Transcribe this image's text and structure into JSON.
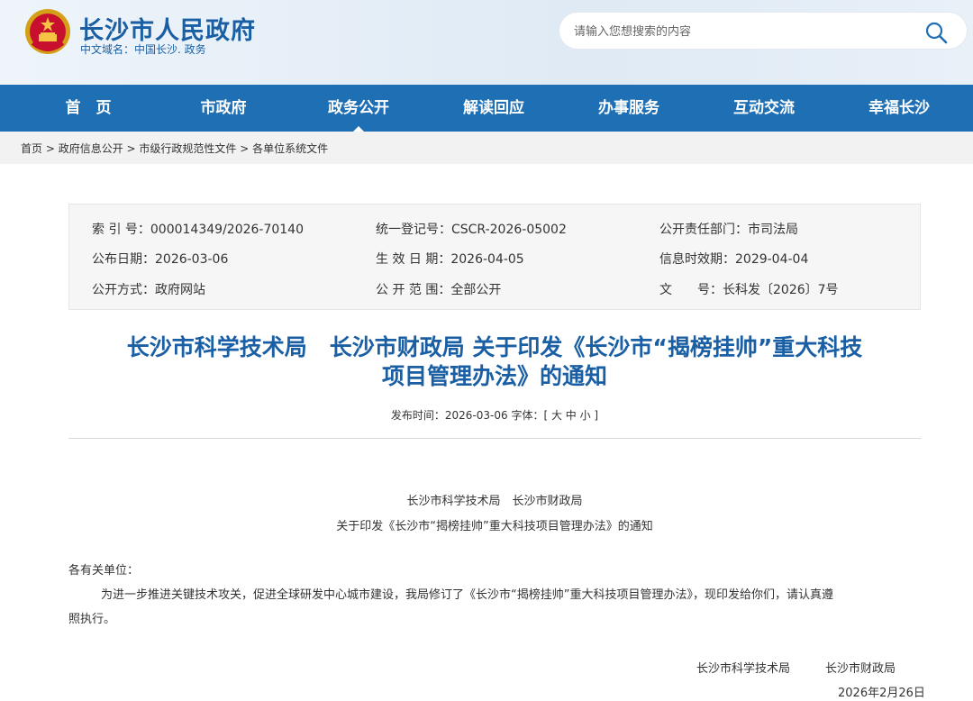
{
  "header": {
    "site_title": "长沙市人民政府",
    "domain_line": "中文域名：中国长沙. 政务",
    "search_placeholder": "请输入您想搜索的内容",
    "emblem_icon": "national-emblem-icon",
    "search_icon": "magnifier-icon"
  },
  "nav": {
    "items": [
      "首　页",
      "市政府",
      "政务公开",
      "解读回应",
      "办事服务",
      "互动交流",
      "幸福长沙"
    ],
    "active_index": 2,
    "bg_color": "#1f6fb5"
  },
  "breadcrumb": {
    "items": [
      "首页",
      "政府信息公开",
      "市级行政规范性文件",
      "各单位系统文件"
    ],
    "separator": " > "
  },
  "meta": {
    "index_no": "索 引 号：000014349/2026-70140",
    "unified_no": "统一登记号：CSCR-2026-05002",
    "department": "公开责任部门：市司法局",
    "publish_date": "公布日期：2026-03-06",
    "effective_date": "生 效 日 期：2026-04-05",
    "expire_date": "信息时效期：2029-04-04",
    "open_method": "公开方式：政府网站",
    "open_scope": "公 开 范 围：全部公开",
    "doc_no": "文　　号：长科发〔2026〕7号"
  },
  "article": {
    "title_line1": "长沙市科学技术局　长沙市财政局 关于印发《长沙市“揭榜挂帅”重大科技",
    "title_line2": "项目管理办法》的通知",
    "pub_line": "发布时间：2026-03-06  字体：[ 大 中 小 ]",
    "issuers_line": "长沙市科学技术局　长沙市财政局",
    "subject_line": "关于印发《长沙市“揭榜挂帅”重大科技项目管理办法》的通知",
    "salutation": "各有关单位：",
    "paragraph1_a": "为进一步推进关键技术攻关，促进全球研发中心城市建设，我局修订了《长沙市“揭榜挂帅”重大科技项目管理办法》，现印发给你们，请认真遵",
    "paragraph1_b": "照执行。",
    "signature": "长沙市科学技术局　　　长沙市财政局",
    "sign_date": "2026年2月26日"
  }
}
